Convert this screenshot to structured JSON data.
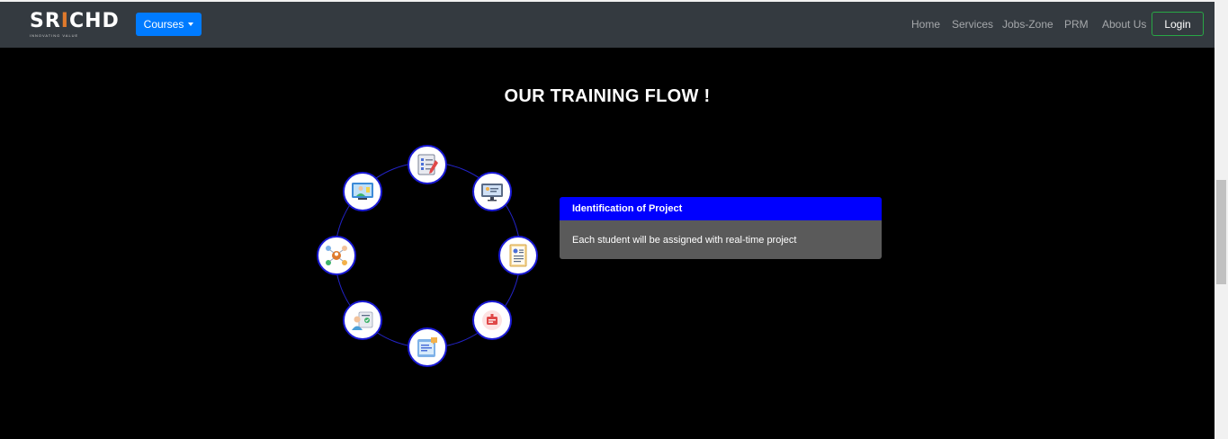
{
  "navbar": {
    "logo_text_a": "SR",
    "logo_text_accent": "I",
    "logo_text_b": "CH",
    "logo_text_c": "D",
    "logo_tagline": "INNOVATING VALUE",
    "courses_label": "Courses",
    "links": [
      "Home",
      "Services",
      "Jobs-Zone",
      "PRM",
      "About Us"
    ],
    "login_label": "Login"
  },
  "section": {
    "title": "OUR TRAINING FLOW !"
  },
  "flow_steps": [
    {
      "icon": "checklist-icon"
    },
    {
      "icon": "monitor-presentation-icon"
    },
    {
      "icon": "resume-document-icon"
    },
    {
      "icon": "task-card-icon"
    },
    {
      "icon": "mobile-chat-icon"
    },
    {
      "icon": "profile-check-icon"
    },
    {
      "icon": "team-network-icon"
    },
    {
      "icon": "online-class-icon"
    }
  ],
  "active_step": {
    "title": "Identification of Project",
    "description": "Each student will be assigned with real-time project"
  },
  "colors": {
    "navbar_bg": "#343a40",
    "primary_blue": "#007bff",
    "card_header": "#0000ff",
    "card_body": "#5a5a5a",
    "login_border": "#28a745",
    "logo_accent": "#e07a2c"
  }
}
